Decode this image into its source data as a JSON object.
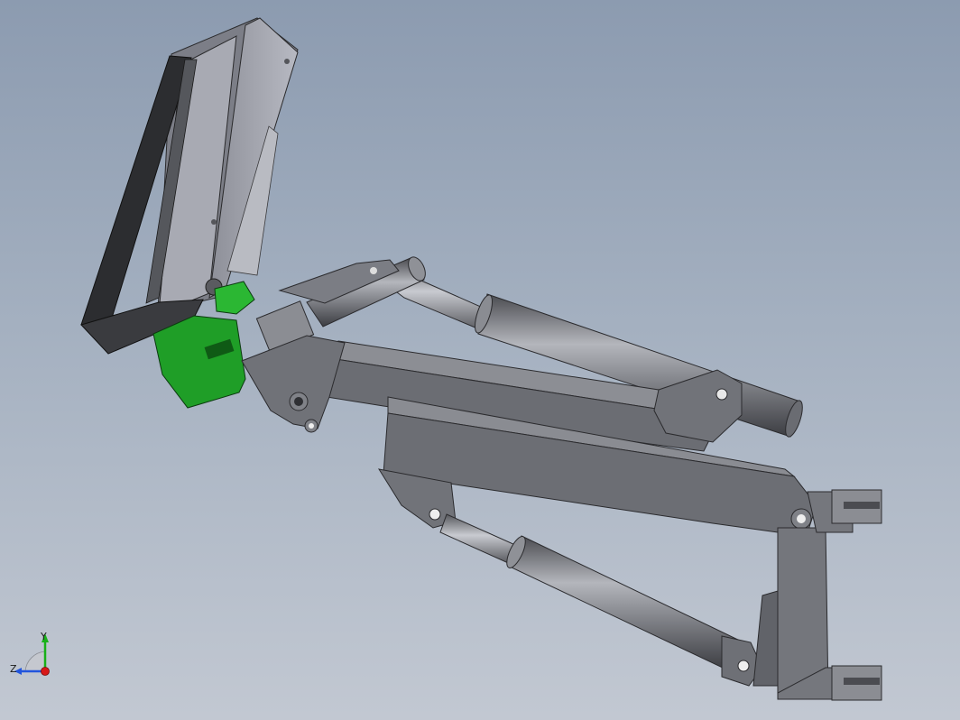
{
  "viewport": {
    "background_top": "#8c9bb0",
    "background_bottom": "#c2c8d2"
  },
  "model": {
    "part_colors": {
      "steel": "#6d6f75",
      "steel_light": "#8a8c92",
      "steel_dark": "#3e3f43",
      "plate_light": "#9c9ea8",
      "bracket_green": "#22a82a"
    }
  },
  "triad": {
    "y_label": "Y",
    "z_label": "Z",
    "y_color": "#19b019",
    "z_color": "#2255dd",
    "x_color": "#d81818"
  }
}
